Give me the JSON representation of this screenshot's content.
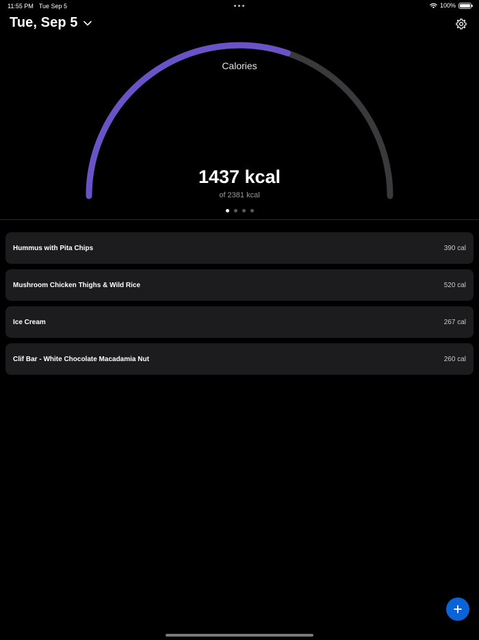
{
  "status_bar": {
    "time": "11:55 PM",
    "date": "Tue Sep 5",
    "battery": "100%",
    "wifi_icon": "wifi-icon",
    "battery_icon": "battery-icon"
  },
  "header": {
    "date_title": "Tue, Sep 5",
    "dropdown_icon": "chevron-down-icon",
    "settings_icon": "gear-icon"
  },
  "gauge": {
    "label": "Calories",
    "value_text": "1437 kcal",
    "goal_text": "of 2381 kcal",
    "consumed": 1437,
    "goal": 2381,
    "progress_color": "#6a52c7",
    "track_color": "#3a3a3c"
  },
  "pager": {
    "count": 4,
    "active_index": 0
  },
  "food_items": [
    {
      "name": "Hummus with Pita Chips",
      "calories": "390 cal"
    },
    {
      "name": "Mushroom Chicken Thighs & Wild Rice",
      "calories": "520 cal"
    },
    {
      "name": "Ice Cream",
      "calories": "267 cal"
    },
    {
      "name": "Clif Bar - White Chocolate Macadamia Nut",
      "calories": "260 cal"
    }
  ],
  "fab": {
    "icon": "plus-icon",
    "color": "#0a64d8"
  }
}
